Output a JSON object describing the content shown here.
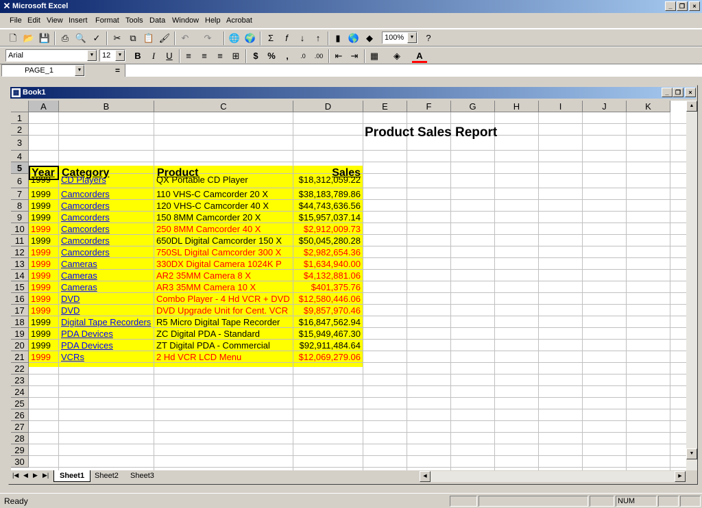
{
  "app": {
    "title": "Microsoft Excel"
  },
  "menu": [
    "File",
    "Edit",
    "View",
    "Insert",
    "Format",
    "Tools",
    "Data",
    "Window",
    "Help",
    "Acrobat"
  ],
  "toolbar": {
    "zoom": "100%",
    "font": "Arial",
    "size": "12"
  },
  "formula": {
    "namebox": "PAGE_1",
    "eq": "="
  },
  "workbook": {
    "title": "Book1"
  },
  "columns": [
    "A",
    "B",
    "C",
    "D",
    "E",
    "F",
    "G",
    "H",
    "I",
    "J",
    "K"
  ],
  "rows": [
    "1",
    "2",
    "3",
    "4",
    "5",
    "6",
    "7",
    "8",
    "9",
    "10",
    "11",
    "12",
    "13",
    "14",
    "15",
    "16",
    "17",
    "18",
    "19",
    "20",
    "21",
    "22",
    "23",
    "24",
    "25",
    "26",
    "27",
    "28",
    "29",
    "30"
  ],
  "report": {
    "title": "Product Sales Report"
  },
  "table": {
    "headers": [
      "Year",
      "Category",
      "Product",
      "Sales"
    ],
    "rows": [
      {
        "year": "1999",
        "category": "CD Players",
        "product": "QX Portable CD Player",
        "sales": "$18,312,059.22",
        "red": false
      },
      {
        "year": "1999",
        "category": "Camcorders",
        "product": "110 VHS-C Camcorder 20 X",
        "sales": "$38,183,789.86",
        "red": false
      },
      {
        "year": "1999",
        "category": "Camcorders",
        "product": "120 VHS-C Camcorder 40 X",
        "sales": "$44,743,636.56",
        "red": false
      },
      {
        "year": "1999",
        "category": "Camcorders",
        "product": "150 8MM Camcorder 20 X",
        "sales": "$15,957,037.14",
        "red": false
      },
      {
        "year": "1999",
        "category": "Camcorders",
        "product": "250 8MM Camcorder 40 X",
        "sales": "$2,912,009.73",
        "red": true
      },
      {
        "year": "1999",
        "category": "Camcorders",
        "product": "650DL Digital Camcorder 150 X",
        "sales": "$50,045,280.28",
        "red": false
      },
      {
        "year": "1999",
        "category": "Camcorders",
        "product": "750SL Digital Camcorder 300 X",
        "sales": "$2,982,654.36",
        "red": true
      },
      {
        "year": "1999",
        "category": "Cameras",
        "product": "330DX Digital Camera 1024K P",
        "sales": "$1,634,940.00",
        "red": true
      },
      {
        "year": "1999",
        "category": "Cameras",
        "product": "AR2 35MM Camera 8 X",
        "sales": "$4,132,881.06",
        "red": true
      },
      {
        "year": "1999",
        "category": "Cameras",
        "product": "AR3 35MM Camera 10 X",
        "sales": "$401,375.76",
        "red": true
      },
      {
        "year": "1999",
        "category": "DVD",
        "product": "Combo Player - 4 Hd VCR + DVD",
        "sales": "$12,580,446.06",
        "red": true
      },
      {
        "year": "1999",
        "category": "DVD",
        "product": "DVD Upgrade Unit for Cent. VCR",
        "sales": "$9,857,970.46",
        "red": true
      },
      {
        "year": "1999",
        "category": "Digital Tape Recorders",
        "product": "R5 Micro Digital Tape Recorder",
        "sales": "$16,847,562.94",
        "red": false
      },
      {
        "year": "1999",
        "category": "PDA Devices",
        "product": "ZC Digital PDA - Standard",
        "sales": "$15,949,467.30",
        "red": false
      },
      {
        "year": "1999",
        "category": "PDA Devices",
        "product": "ZT Digital PDA - Commercial",
        "sales": "$92,911,484.64",
        "red": false
      },
      {
        "year": "1999",
        "category": "VCRs",
        "product": "2 Hd VCR LCD Menu",
        "sales": "$12,069,279.06",
        "red": true
      }
    ]
  },
  "sheets": [
    "Sheet1",
    "Sheet2",
    "Sheet3"
  ],
  "status": {
    "left": "Ready",
    "num": "NUM"
  }
}
